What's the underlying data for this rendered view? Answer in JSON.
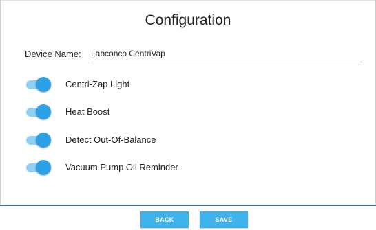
{
  "title": "Configuration",
  "device": {
    "label": "Device Name:",
    "value": "Labconco CentriVap"
  },
  "toggles": [
    {
      "label": "Centri-Zap Light",
      "on": true
    },
    {
      "label": "Heat Boost",
      "on": true
    },
    {
      "label": "Detect Out-Of-Balance",
      "on": true
    },
    {
      "label": "Vacuum Pump Oil Reminder",
      "on": true
    }
  ],
  "footer": {
    "back_label": "BACK",
    "save_label": "SAVE"
  },
  "colors": {
    "accent": "#2da1e6",
    "track": "#8ecff4",
    "button": "#3fb2ec",
    "footer_rule": "#4a6fa5"
  }
}
